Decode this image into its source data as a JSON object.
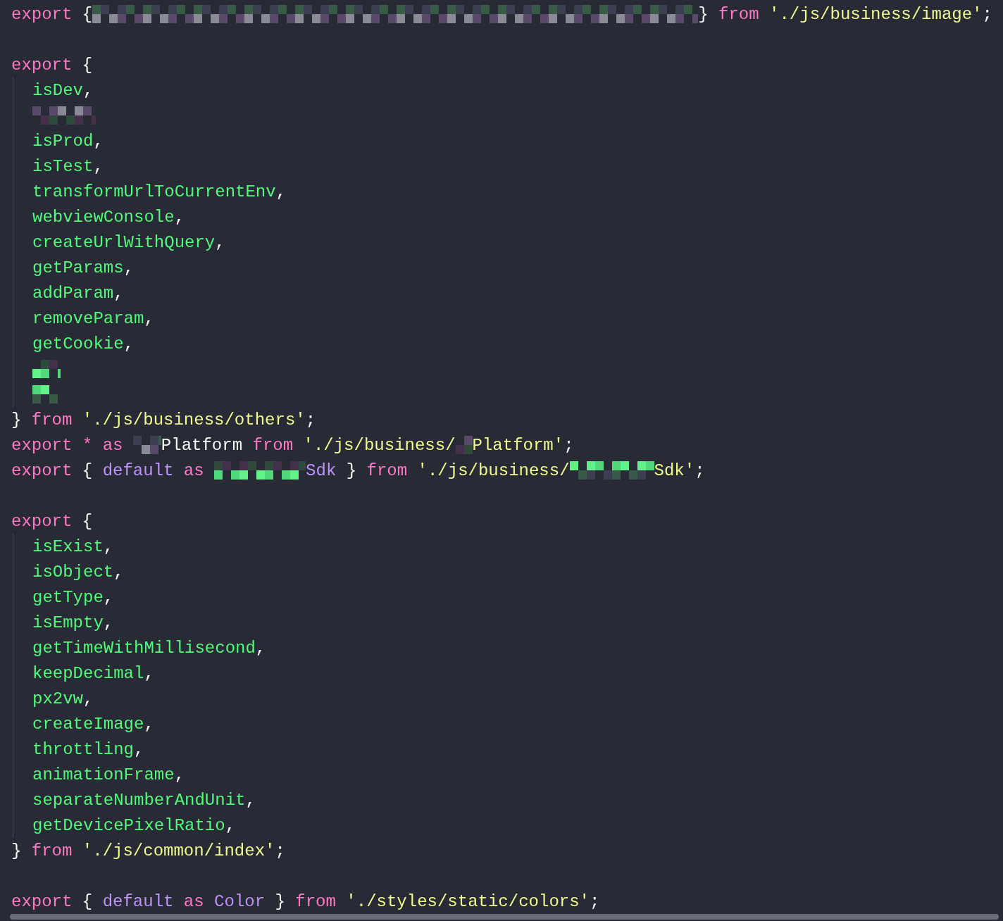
{
  "editor": {
    "lines": [
      {
        "kind": "code",
        "indent": false,
        "tokens": [
          {
            "kind": "keyword",
            "text": "export "
          },
          {
            "kind": "punct",
            "text": "{"
          },
          {
            "kind": "redacted"
          },
          {
            "kind": "punct",
            "text": "} "
          },
          {
            "kind": "keyword",
            "text": "from "
          },
          {
            "kind": "string",
            "text": "'./js/business/image'"
          },
          {
            "kind": "punct",
            "text": ";"
          }
        ]
      },
      {
        "kind": "blank"
      },
      {
        "kind": "code",
        "indent": false,
        "tokens": [
          {
            "kind": "keyword",
            "text": "export "
          },
          {
            "kind": "punct",
            "text": "{"
          }
        ]
      },
      {
        "kind": "code",
        "indent": true,
        "tokens": [
          {
            "kind": "identifier",
            "text": "isDev"
          },
          {
            "kind": "punct",
            "text": ","
          }
        ]
      },
      {
        "kind": "code",
        "indent": true,
        "tokens": [
          {
            "kind": "redacted"
          }
        ]
      },
      {
        "kind": "code",
        "indent": true,
        "tokens": [
          {
            "kind": "identifier",
            "text": "isProd"
          },
          {
            "kind": "punct",
            "text": ","
          }
        ]
      },
      {
        "kind": "code",
        "indent": true,
        "tokens": [
          {
            "kind": "identifier",
            "text": "isTest"
          },
          {
            "kind": "punct",
            "text": ","
          }
        ]
      },
      {
        "kind": "code",
        "indent": true,
        "tokens": [
          {
            "kind": "identifier",
            "text": "transformUrlToCurrentEnv"
          },
          {
            "kind": "punct",
            "text": ","
          }
        ]
      },
      {
        "kind": "code",
        "indent": true,
        "tokens": [
          {
            "kind": "identifier",
            "text": "webviewConsole"
          },
          {
            "kind": "punct",
            "text": ","
          }
        ]
      },
      {
        "kind": "code",
        "indent": true,
        "tokens": [
          {
            "kind": "identifier",
            "text": "createUrlWithQuery"
          },
          {
            "kind": "punct",
            "text": ","
          }
        ]
      },
      {
        "kind": "code",
        "indent": true,
        "tokens": [
          {
            "kind": "identifier",
            "text": "getParams"
          },
          {
            "kind": "punct",
            "text": ","
          }
        ]
      },
      {
        "kind": "code",
        "indent": true,
        "tokens": [
          {
            "kind": "identifier",
            "text": "addParam"
          },
          {
            "kind": "punct",
            "text": ","
          }
        ]
      },
      {
        "kind": "code",
        "indent": true,
        "tokens": [
          {
            "kind": "identifier",
            "text": "removeParam"
          },
          {
            "kind": "punct",
            "text": ","
          }
        ]
      },
      {
        "kind": "code",
        "indent": true,
        "tokens": [
          {
            "kind": "identifier",
            "text": "getCookie"
          },
          {
            "kind": "punct",
            "text": ","
          }
        ]
      },
      {
        "kind": "code",
        "indent": true,
        "tokens": [
          {
            "kind": "redacted"
          }
        ]
      },
      {
        "kind": "code",
        "indent": true,
        "tokens": [
          {
            "kind": "redacted"
          }
        ]
      },
      {
        "kind": "code",
        "indent": false,
        "tokens": [
          {
            "kind": "punct",
            "text": "} "
          },
          {
            "kind": "keyword",
            "text": "from "
          },
          {
            "kind": "string",
            "text": "'./js/business/others'"
          },
          {
            "kind": "punct",
            "text": ";"
          }
        ]
      },
      {
        "kind": "code",
        "indent": false,
        "tokens": [
          {
            "kind": "keyword",
            "text": "export "
          },
          {
            "kind": "keyword",
            "text": "* "
          },
          {
            "kind": "keyword",
            "text": "as "
          },
          {
            "kind": "redacted"
          },
          {
            "kind": "punct",
            "text": "Platform "
          },
          {
            "kind": "keyword",
            "text": "from "
          },
          {
            "kind": "string",
            "text": "'./js/business/"
          },
          {
            "kind": "redacted"
          },
          {
            "kind": "string",
            "text": "Platform'"
          },
          {
            "kind": "punct",
            "text": ";"
          }
        ]
      },
      {
        "kind": "code",
        "indent": false,
        "tokens": [
          {
            "kind": "keyword",
            "text": "export "
          },
          {
            "kind": "punct",
            "text": "{ "
          },
          {
            "kind": "class",
            "text": "default "
          },
          {
            "kind": "keyword",
            "text": "as "
          },
          {
            "kind": "redacted"
          },
          {
            "kind": "class",
            "text": "Sdk "
          },
          {
            "kind": "punct",
            "text": "} "
          },
          {
            "kind": "keyword",
            "text": "from "
          },
          {
            "kind": "string",
            "text": "'./js/business/"
          },
          {
            "kind": "redacted"
          },
          {
            "kind": "string",
            "text": "Sdk'"
          },
          {
            "kind": "punct",
            "text": ";"
          }
        ]
      },
      {
        "kind": "blank"
      },
      {
        "kind": "code",
        "indent": false,
        "tokens": [
          {
            "kind": "keyword",
            "text": "export "
          },
          {
            "kind": "punct",
            "text": "{"
          }
        ]
      },
      {
        "kind": "code",
        "indent": true,
        "tokens": [
          {
            "kind": "identifier",
            "text": "isExist"
          },
          {
            "kind": "punct",
            "text": ","
          }
        ]
      },
      {
        "kind": "code",
        "indent": true,
        "tokens": [
          {
            "kind": "identifier",
            "text": "isObject"
          },
          {
            "kind": "punct",
            "text": ","
          }
        ]
      },
      {
        "kind": "code",
        "indent": true,
        "tokens": [
          {
            "kind": "identifier",
            "text": "getType"
          },
          {
            "kind": "punct",
            "text": ","
          }
        ]
      },
      {
        "kind": "code",
        "indent": true,
        "tokens": [
          {
            "kind": "identifier",
            "text": "isEmpty"
          },
          {
            "kind": "punct",
            "text": ","
          }
        ]
      },
      {
        "kind": "code",
        "indent": true,
        "tokens": [
          {
            "kind": "identifier",
            "text": "getTimeWithMillisecond"
          },
          {
            "kind": "punct",
            "text": ","
          }
        ]
      },
      {
        "kind": "code",
        "indent": true,
        "tokens": [
          {
            "kind": "identifier",
            "text": "keepDecimal"
          },
          {
            "kind": "punct",
            "text": ","
          }
        ]
      },
      {
        "kind": "code",
        "indent": true,
        "tokens": [
          {
            "kind": "identifier",
            "text": "px2vw"
          },
          {
            "kind": "punct",
            "text": ","
          }
        ]
      },
      {
        "kind": "code",
        "indent": true,
        "tokens": [
          {
            "kind": "identifier",
            "text": "createImage"
          },
          {
            "kind": "punct",
            "text": ","
          }
        ]
      },
      {
        "kind": "code",
        "indent": true,
        "tokens": [
          {
            "kind": "identifier",
            "text": "throttling"
          },
          {
            "kind": "punct",
            "text": ","
          }
        ]
      },
      {
        "kind": "code",
        "indent": true,
        "tokens": [
          {
            "kind": "identifier",
            "text": "animationFrame"
          },
          {
            "kind": "punct",
            "text": ","
          }
        ]
      },
      {
        "kind": "code",
        "indent": true,
        "tokens": [
          {
            "kind": "identifier",
            "text": "separateNumberAndUnit"
          },
          {
            "kind": "punct",
            "text": ","
          }
        ]
      },
      {
        "kind": "code",
        "indent": true,
        "tokens": [
          {
            "kind": "identifier",
            "text": "getDevicePixelRatio"
          },
          {
            "kind": "punct",
            "text": ","
          }
        ]
      },
      {
        "kind": "code",
        "indent": false,
        "tokens": [
          {
            "kind": "punct",
            "text": "} "
          },
          {
            "kind": "keyword",
            "text": "from "
          },
          {
            "kind": "string",
            "text": "'./js/common/index'"
          },
          {
            "kind": "punct",
            "text": ";"
          }
        ]
      },
      {
        "kind": "blank"
      },
      {
        "kind": "code",
        "indent": false,
        "tokens": [
          {
            "kind": "keyword",
            "text": "export "
          },
          {
            "kind": "punct",
            "text": "{ "
          },
          {
            "kind": "class",
            "text": "default "
          },
          {
            "kind": "keyword",
            "text": "as "
          },
          {
            "kind": "class",
            "text": "Color "
          },
          {
            "kind": "punct",
            "text": "} "
          },
          {
            "kind": "keyword",
            "text": "from "
          },
          {
            "kind": "string",
            "text": "'./styles/static/colors'"
          },
          {
            "kind": "punct",
            "text": ";"
          }
        ]
      }
    ]
  }
}
